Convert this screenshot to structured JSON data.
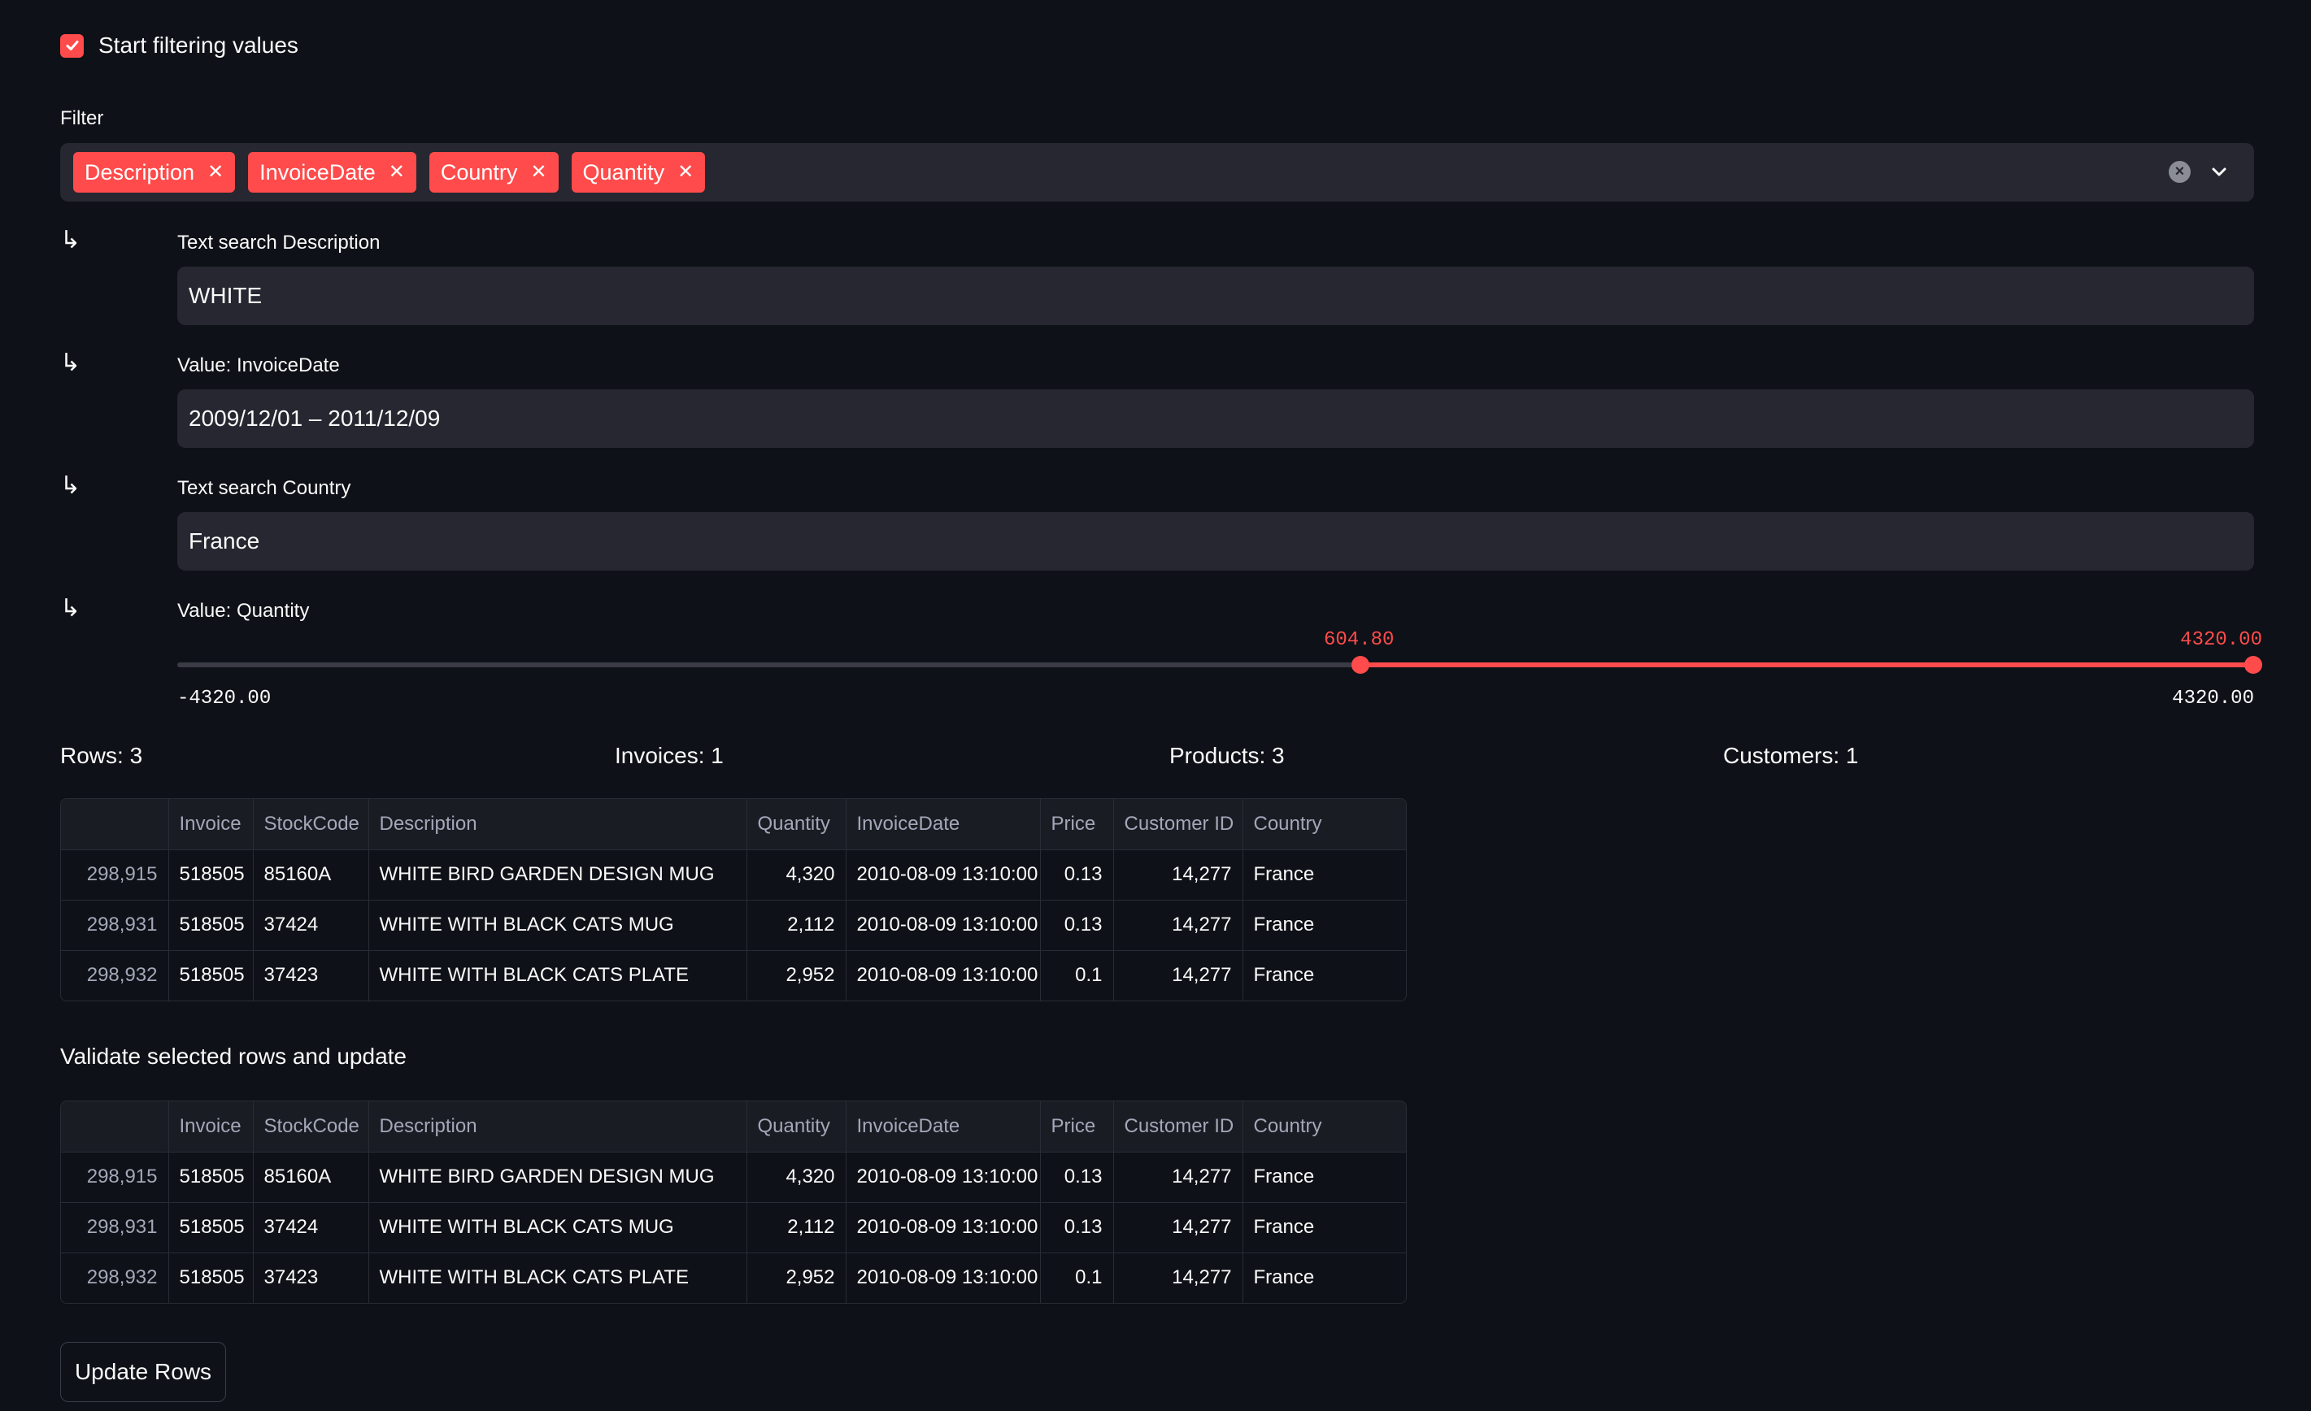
{
  "filtering_checkbox": {
    "label": "Start filtering values",
    "checked": true
  },
  "filter": {
    "label": "Filter",
    "tags": [
      "Description",
      "InvoiceDate",
      "Country",
      "Quantity"
    ]
  },
  "sub_filters": {
    "arrow": "↳",
    "description": {
      "label": "Text search Description",
      "value": "WHITE"
    },
    "invoice_date": {
      "label": "Value: InvoiceDate",
      "value": "2009/12/01 – 2011/12/09"
    },
    "country": {
      "label": "Text search Country",
      "value": "France"
    },
    "quantity": {
      "label": "Value: Quantity",
      "min": "-4320.00",
      "max": "4320.00",
      "low_value": "604.80",
      "high_value": "4320.00",
      "low_fraction": 0.57,
      "high_fraction": 1.0
    }
  },
  "metrics": {
    "rows": "Rows: 3",
    "invoices": "Invoices: 1",
    "products": "Products: 3",
    "customers": "Customers: 1"
  },
  "table_columns": [
    "",
    "Invoice",
    "StockCode",
    "Description",
    "Quantity",
    "InvoiceDate",
    "Price",
    "Customer ID",
    "Country"
  ],
  "table_rows": [
    [
      "298,915",
      "518505",
      "85160A",
      "WHITE BIRD GARDEN DESIGN MUG",
      "4,320",
      "2010-08-09 13:10:00",
      "0.13",
      "14,277",
      "France"
    ],
    [
      "298,931",
      "518505",
      "37424",
      "WHITE WITH BLACK CATS MUG",
      "2,112",
      "2010-08-09 13:10:00",
      "0.13",
      "14,277",
      "France"
    ],
    [
      "298,932",
      "518505",
      "37423",
      "WHITE WITH BLACK CATS PLATE",
      "2,952",
      "2010-08-09 13:10:00",
      "0.1",
      "14,277",
      "France"
    ]
  ],
  "validate_heading": "Validate selected rows and update",
  "update_button": "Update Rows",
  "colors": {
    "accent": "#ff4b4b",
    "background": "#0e1117",
    "input": "#262730"
  },
  "icons": {
    "clear": "clear-circle-icon",
    "chevron": "chevron-down-icon",
    "check": "check-icon"
  }
}
